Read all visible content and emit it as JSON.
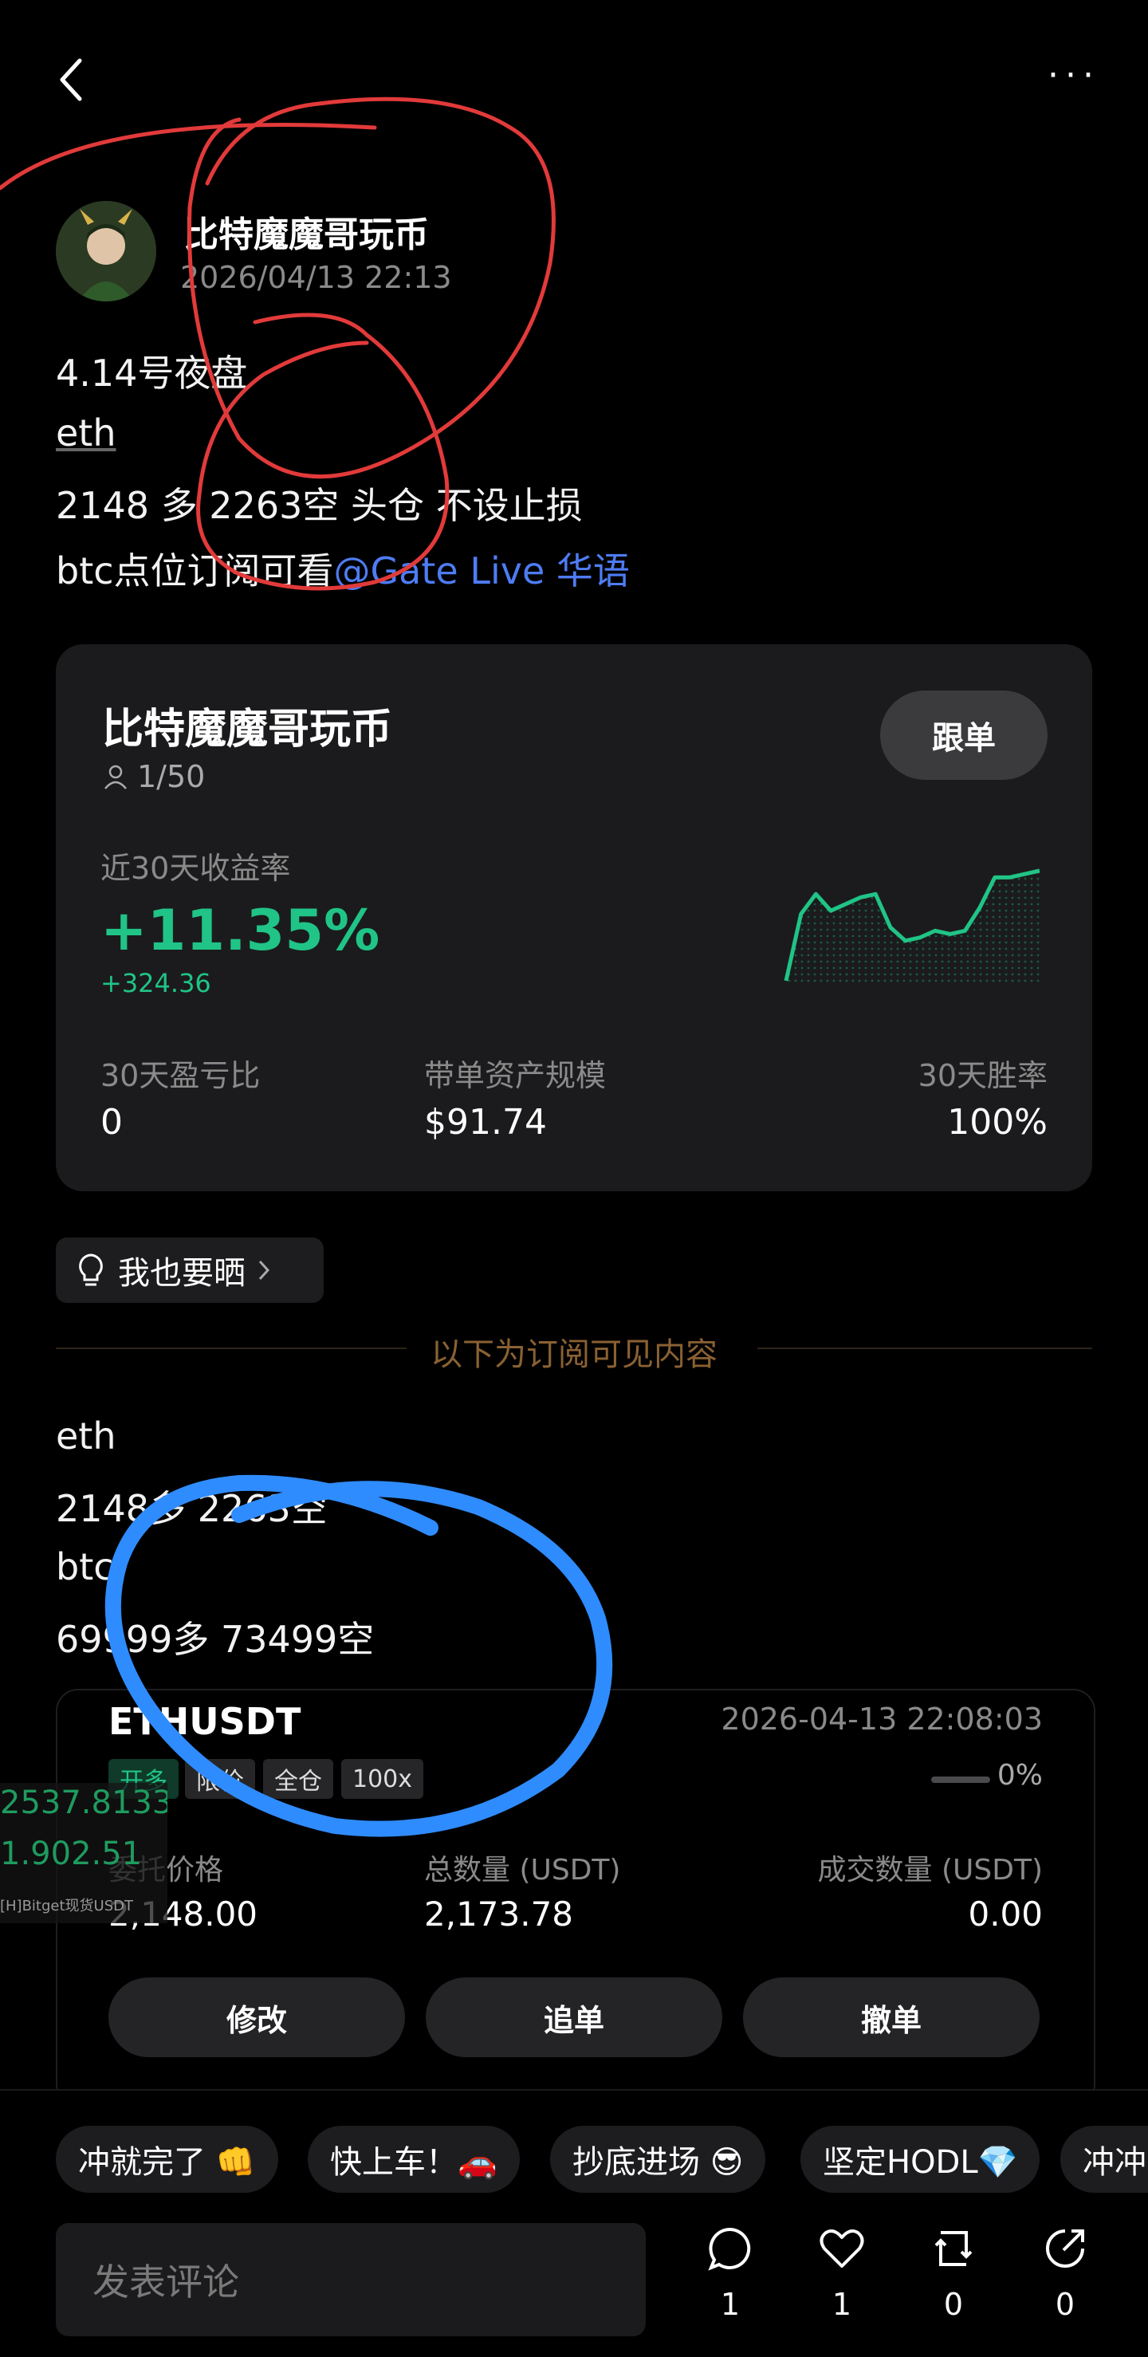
{
  "header": {
    "back_icon": "chevron-left-icon",
    "more_label": "···"
  },
  "author": {
    "name": "比特魔魔哥玩币",
    "time": "2026/04/13 22:13"
  },
  "post": {
    "lines": [
      "4.14号夜盘",
      "eth",
      "2148 多  2263空  头仓 不设止损",
      "btc点位订阅可看"
    ],
    "mention": "@Gate Live 华语"
  },
  "card": {
    "name": "比特魔魔哥玩币",
    "follow_label": "跟单",
    "followers": "1/50",
    "return_label": "近30天收益率",
    "return_pct": "+11.35%",
    "return_abs": "+324.36",
    "chart_data": {
      "type": "line",
      "values": [
        0,
        2,
        2.6,
        2.1,
        2.3,
        2.5,
        2.6,
        1.6,
        1.2,
        1.3,
        1.5,
        1.4,
        1.5,
        2.2,
        3.1,
        3.1,
        3.2,
        3.3
      ],
      "color": "#20c486"
    },
    "stats": [
      {
        "label": "30天盈亏比",
        "value": "0"
      },
      {
        "label": "带单资产规模",
        "value": "$91.74"
      },
      {
        "label": "30天胜率",
        "value": "100%"
      }
    ]
  },
  "share_chip": {
    "icon": "lightbulb-icon",
    "label": "我也要晒"
  },
  "divider_text": "以下为订阅可见内容",
  "subscriber": {
    "lines": [
      "eth",
      "2148多  2263空",
      "btc",
      "69999多  73499空"
    ]
  },
  "order": {
    "pair": "ETHUSDT",
    "time": "2026-04-13 22:08:03",
    "tags": [
      "开多",
      "限价",
      "全仓",
      "100x"
    ],
    "progress_pct": "0%",
    "progress_fraction": 0,
    "fields": [
      {
        "label": "委托价格",
        "value": "2,148.00"
      },
      {
        "label": "总数量 (USDT)",
        "value": "2,173.78"
      },
      {
        "label": "成交数量 (USDT)",
        "value": "0.00"
      }
    ],
    "buttons": [
      "修改",
      "追单",
      "撤单"
    ]
  },
  "ticker_overlay": {
    "line1": "2537.8133.",
    "line2": "1.902.51",
    "line3": "[H]Bitget现货USDT"
  },
  "quick_replies": [
    "冲就完了 👊",
    "快上车！🚗",
    "抄底进场 😎",
    "坚定HODL💎",
    "冲冲"
  ],
  "comment": {
    "placeholder": "发表评论"
  },
  "actions": [
    {
      "icon": "comment-icon",
      "count": "1"
    },
    {
      "icon": "heart-icon",
      "count": "1"
    },
    {
      "icon": "repost-icon",
      "count": "0"
    },
    {
      "icon": "share-icon",
      "count": "0"
    }
  ],
  "colors": {
    "accent_green": "#20c486",
    "mention_blue": "#4e7cf3",
    "annotation_red": "#e23a3a",
    "annotation_blue": "#2f8cff"
  }
}
